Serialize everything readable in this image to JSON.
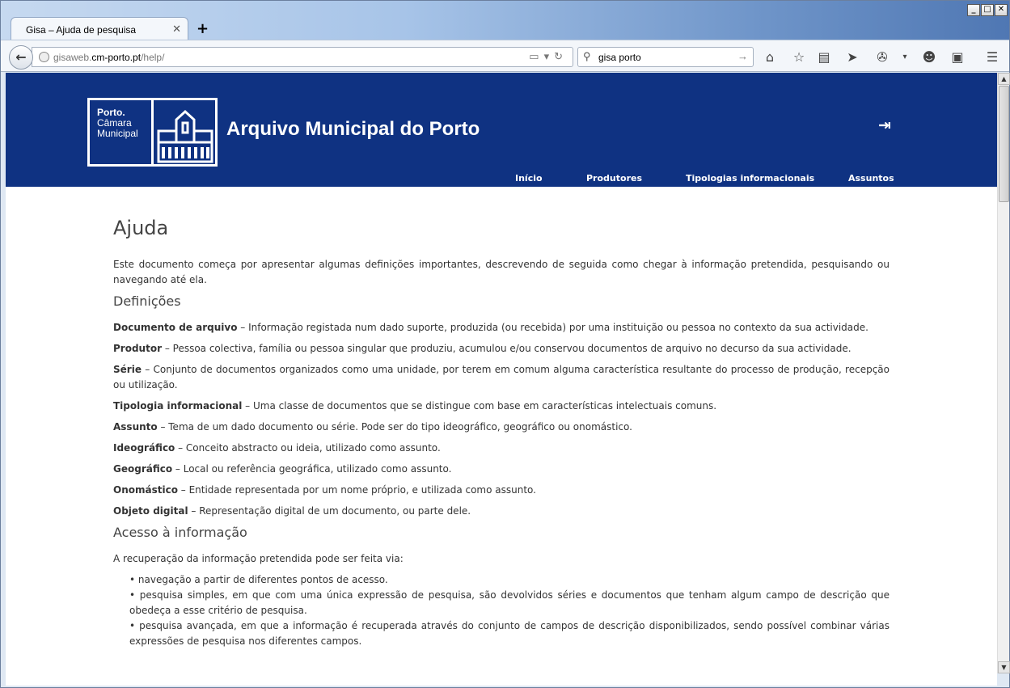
{
  "browser": {
    "tab_title": "Gisa – Ajuda de pesquisa",
    "tab_close": "✕",
    "new_tab": "+",
    "url_prefix": "gisaweb.",
    "url_domain": "cm-porto.pt",
    "url_path": "/help/",
    "search_value": "gisa porto",
    "window_min": "_",
    "window_max": "□",
    "window_close": "✕"
  },
  "site": {
    "logo_line1": "Porto.",
    "logo_line2": "Câmara",
    "logo_line3": "Municipal",
    "title": "Arquivo Municipal do Porto",
    "nav": [
      "Início",
      "Produtores",
      "Tipologias informacionais",
      "Assuntos"
    ],
    "header_color": "#0f3282"
  },
  "page": {
    "heading": "Ajuda",
    "intro": "Este documento começa por apresentar algumas definições importantes, descrevendo de seguida como chegar à informação pretendida, pesquisando ou navegando até ela.",
    "definitions_heading": "Definições",
    "definitions": [
      {
        "term": "Documento de arquivo",
        "text": " – Informação registada num dado suporte, produzida (ou recebida) por uma instituição ou pessoa no contexto da sua actividade."
      },
      {
        "term": "Produtor",
        "text": " – Pessoa colectiva, família ou pessoa singular que produziu, acumulou e/ou conservou documentos de arquivo no decurso da sua actividade."
      },
      {
        "term": "Série",
        "text": " – Conjunto de documentos organizados como uma unidade, por terem em comum alguma característica resultante do processo de produção, recepção ou utilização."
      },
      {
        "term": "Tipologia informacional",
        "text": " – Uma classe de documentos que se distingue com base em características intelectuais comuns."
      },
      {
        "term": "Assunto",
        "text": " – Tema de um dado documento ou série. Pode ser do tipo ideográfico, geográfico ou onomástico."
      },
      {
        "term": "Ideográfico",
        "text": " – Conceito abstracto ou ideia, utilizado como assunto."
      },
      {
        "term": "Geográfico",
        "text": " – Local ou referência geográfica, utilizado como assunto."
      },
      {
        "term": "Onomástico",
        "text": " – Entidade representada por um nome próprio, e utilizada como assunto."
      },
      {
        "term": "Objeto digital",
        "text": " – Representação digital de um documento, ou parte dele."
      }
    ],
    "access_heading": "Acesso à informação",
    "access_intro": "A recuperação da informação pretendida pode ser feita via:",
    "access_items": [
      "navegação a partir de diferentes pontos de acesso.",
      "pesquisa simples, em que com uma única expressão de pesquisa, são devolvidos séries e documentos que tenham algum campo de descrição que obedeça a esse critério de pesquisa.",
      "pesquisa avançada, em que a informação é recuperada através do conjunto de campos de descrição disponibilizados, sendo possível combinar várias expressões de pesquisa nos diferentes campos."
    ]
  }
}
